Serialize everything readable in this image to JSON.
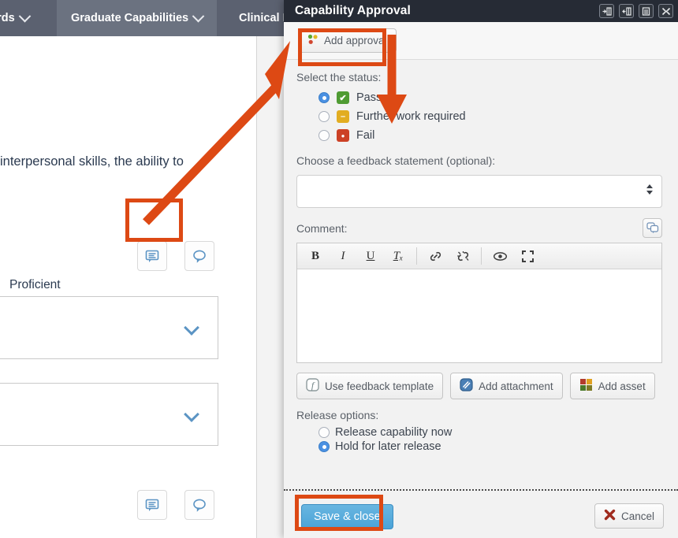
{
  "background": {
    "tabs": [
      {
        "label": "lards",
        "icon": "chevron-down-icon",
        "active": false
      },
      {
        "label": "Graduate Capabilities",
        "icon": "chevron-down-icon",
        "active": true
      },
      {
        "label": "Clinical Pl",
        "icon": "",
        "active": false
      }
    ],
    "body_text": "interpersonal skills, the ability to",
    "proficient_label": "Proficient",
    "comment_icon": "comment-lines-icon",
    "speech_icon": "speech-bubble-icon",
    "panel_chevron_icon": "chevron-down-icon"
  },
  "dialog": {
    "title": "Capability Approval",
    "title_icons": [
      "dock-right-icon",
      "dock-left-icon",
      "restore-window-icon",
      "maximize-window-icon"
    ],
    "toolbar": {
      "add_approval_label": "Add approval",
      "add_approval_icon": "traffic-dots-icon"
    },
    "status": {
      "label": "Select the status:",
      "options": [
        {
          "label": "Pass",
          "icon": "check-circle-icon",
          "selected": true,
          "color": "#4f9b33",
          "glyph": "✔"
        },
        {
          "label": "Further work required",
          "icon": "minus-circle-icon",
          "selected": false,
          "color": "#e2ad21",
          "glyph": "–"
        },
        {
          "label": "Fail",
          "icon": "dot-circle-icon",
          "selected": false,
          "color": "#cc4125",
          "glyph": "●"
        }
      ]
    },
    "feedback": {
      "label": "Choose a feedback statement (optional):",
      "value": "",
      "placeholder": "",
      "spinner_icon": "spinner-arrows-icon"
    },
    "comment": {
      "label": "Comment:",
      "bubble_button_icon": "double-speech-bubble-icon",
      "toolbar_buttons": [
        {
          "name": "bold-button",
          "glyph": "B",
          "style": "bold"
        },
        {
          "name": "italic-button",
          "glyph": "I",
          "style": "italic"
        },
        {
          "name": "underline-button",
          "glyph": "U",
          "style": "underline"
        },
        {
          "name": "remove-format-button",
          "glyph": "Tₓ",
          "style": "italic"
        },
        {
          "name": "link-button",
          "glyph": "🔗",
          "style": "plain"
        },
        {
          "name": "unlink-button",
          "glyph": "✂",
          "style": "plain"
        },
        {
          "name": "preview-button",
          "glyph": "👁",
          "style": "plain"
        },
        {
          "name": "maximize-button",
          "glyph": "⤡",
          "style": "plain"
        }
      ],
      "body_value": ""
    },
    "attachment_buttons": [
      {
        "label": "Use feedback template",
        "icon": "feedback-template-icon",
        "color": "#7e8a8c"
      },
      {
        "label": "Add attachment",
        "icon": "attachment-icon",
        "color": "#3a6fa8"
      },
      {
        "label": "Add asset",
        "icon": "asset-grid-icon",
        "color": "#b03a2e"
      }
    ],
    "release": {
      "label": "Release options:",
      "options": [
        {
          "label": "Release capability now",
          "selected": false
        },
        {
          "label": "Hold for later release",
          "selected": true
        }
      ]
    },
    "footer": {
      "save_label": "Save & close",
      "cancel_label": "Cancel",
      "cancel_icon": "close-x-icon"
    }
  },
  "annotations": {
    "highlight_color": "#dd4914",
    "boxes": [
      {
        "name": "add-approval-highlight"
      },
      {
        "name": "comment-icon-highlight"
      },
      {
        "name": "save-close-highlight"
      }
    ],
    "arrows": [
      {
        "name": "arrow-comment-to-add-approval"
      },
      {
        "name": "arrow-add-approval-to-status"
      }
    ]
  },
  "colors": {
    "accent_orange": "#dd4914",
    "title_bar": "#262b35",
    "tab_bar": "#5b6170",
    "primary_blue": "#4aa3d8"
  }
}
